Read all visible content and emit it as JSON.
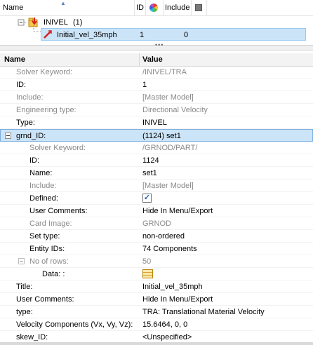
{
  "tree": {
    "columns": {
      "name": "Name",
      "id": "ID",
      "include": "Include"
    },
    "parent": {
      "label": "INIVEL",
      "count": "(1)"
    },
    "child": {
      "label": "Initial_vel_35mph",
      "id": "1",
      "include": "0"
    }
  },
  "grid": {
    "headers": {
      "name": "Name",
      "value": "Value"
    },
    "rows_top": [
      {
        "key": "Solver Keyword:",
        "value": "/INIVEL/TRA",
        "muted": true
      },
      {
        "key": "ID:",
        "value": "1",
        "muted": false
      },
      {
        "key": "Include:",
        "value": "[Master Model]",
        "muted": true
      },
      {
        "key": "Engineering type:",
        "value": "Directional Velocity",
        "muted": true
      },
      {
        "key": "Type:",
        "value": "INIVEL",
        "muted": false
      }
    ],
    "group": {
      "key": "grnd_ID:",
      "value": "(1124) set1"
    },
    "group_rows": [
      {
        "key": "Solver Keyword:",
        "value": "/GRNOD/PART/",
        "muted": true
      },
      {
        "key": "ID:",
        "value": "1124",
        "muted": false
      },
      {
        "key": "Name:",
        "value": "set1",
        "muted": false
      },
      {
        "key": "Include:",
        "value": "[Master Model]",
        "muted": true
      },
      {
        "key": "Defined:",
        "value": "",
        "muted": false
      },
      {
        "key": "User Comments:",
        "value": "Hide In Menu/Export",
        "muted": false
      },
      {
        "key": "Card Image:",
        "value": "GRNOD",
        "muted": true
      },
      {
        "key": "Set type:",
        "value": "non-ordered",
        "muted": false
      },
      {
        "key": "Entity IDs:",
        "value": "74 Components",
        "muted": false
      }
    ],
    "rows_node": {
      "key": "No of rows:",
      "value": "50"
    },
    "data_row": {
      "key": "Data: :"
    },
    "rows_bottom": [
      {
        "key": "Title:",
        "value": "Initial_vel_35mph"
      },
      {
        "key": "User Comments:",
        "value": "Hide In Menu/Export"
      },
      {
        "key": "type:",
        "value": "TRA: Translational Material Velocity"
      },
      {
        "key": "Velocity Components (Vx, Vy, Vz):",
        "value": "15.6464, 0, 0"
      },
      {
        "key": "skew_ID:",
        "value": "<Unspecified>"
      }
    ]
  },
  "colors": {
    "selection": "#cce4f7",
    "selection_border": "#7aaee0",
    "muted_text": "#8a8a8a"
  }
}
